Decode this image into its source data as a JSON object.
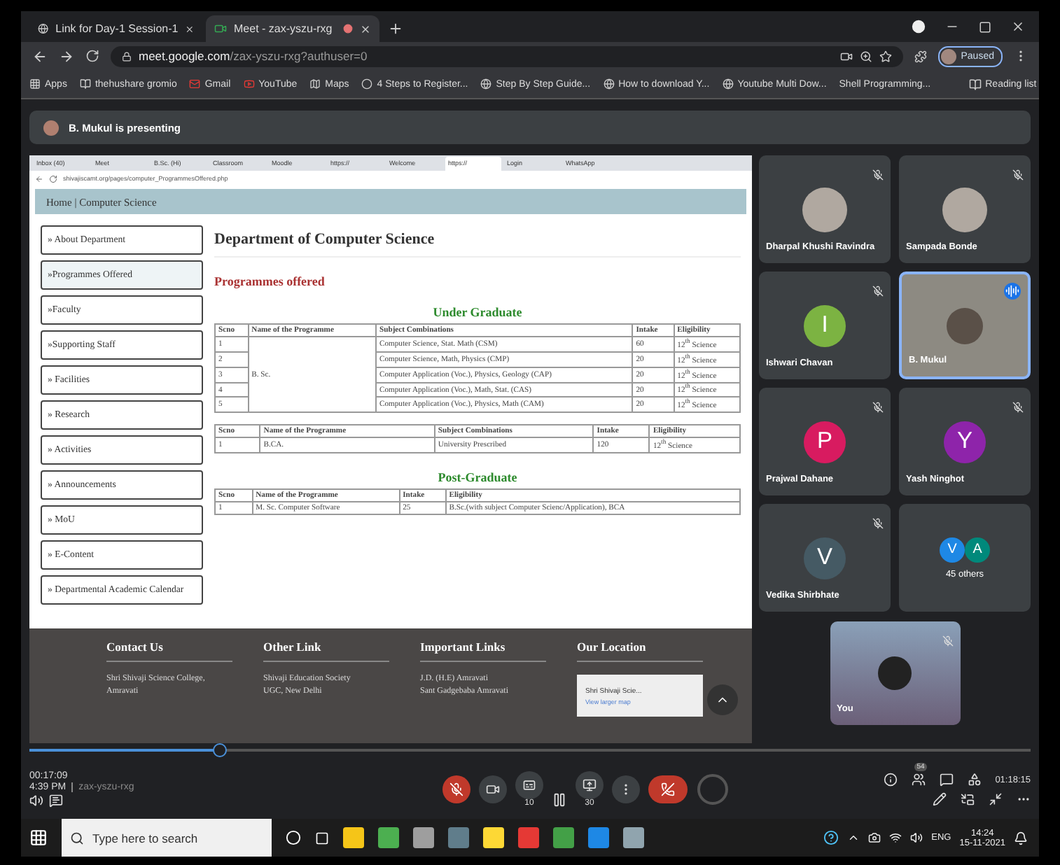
{
  "browser": {
    "tabs": [
      {
        "label": "Link for Day-1 Session-1",
        "selected": false,
        "recording": false
      },
      {
        "label": "Meet - zax-yszu-rxg",
        "selected": true,
        "recording": true
      }
    ],
    "url_host": "meet.google.com",
    "url_path": "/zax-yszu-rxg?authuser=0",
    "profile": "Paused",
    "bookmarks": [
      "Apps",
      "thehushare gromio",
      "Gmail",
      "YouTube",
      "Maps",
      "4 Steps to Register...",
      "Step By Step Guide...",
      "How to download Y...",
      "Youtube Multi Dow...",
      "Shell Programming..."
    ],
    "reading_list": "Reading list"
  },
  "presenting": "B. Mukul is presenting",
  "shared_screen": {
    "tabs": [
      {
        "label": "Inbox (40)",
        "selected": false
      },
      {
        "label": "Meet",
        "selected": false
      },
      {
        "label": "B.Sc. (Hi)",
        "selected": false
      },
      {
        "label": "Classroom",
        "selected": false
      },
      {
        "label": "Moodle",
        "selected": false
      },
      {
        "label": "https://",
        "selected": false
      },
      {
        "label": "Welcome",
        "selected": false
      },
      {
        "label": "https://",
        "selected": true
      },
      {
        "label": "Login",
        "selected": false
      },
      {
        "label": "WhatsApp",
        "selected": false
      }
    ],
    "url": "shivajiscamt.org/pages/computer_ProgrammesOffered.php",
    "breadcrumb": "Home | Computer Science",
    "menu": [
      {
        "label": "» About Department",
        "selected": false
      },
      {
        "label": "»Programmes Offered",
        "selected": true
      },
      {
        "label": "»Faculty",
        "selected": false
      },
      {
        "label": "»Supporting Staff",
        "selected": false
      },
      {
        "label": "» Facilities",
        "selected": false
      },
      {
        "label": "» Research",
        "selected": false
      },
      {
        "label": "» Activities",
        "selected": false
      },
      {
        "label": "» Announcements",
        "selected": false
      },
      {
        "label": "» MoU",
        "selected": false
      },
      {
        "label": "» E-Content",
        "selected": false
      },
      {
        "label": "» Departmental Academic Calendar",
        "selected": false
      }
    ],
    "heading": "Department of Computer Science",
    "subheading": "Programmes offered",
    "sections": [
      {
        "title": "Under Graduate",
        "tables": [
          {
            "kind": "grouped",
            "columns": [
              "Scno",
              "Name of the Programme",
              "Subject Combinations",
              "Intake",
              "Eligibility"
            ],
            "groups": [
              {
                "programme": "B. Sc.",
                "rows": [
                  [
                    "1",
                    "Computer Science, Stat. Math (CSM)",
                    "60",
                    "12$^{th}$ Science"
                  ],
                  [
                    "2",
                    "Computer Science, Math, Physics (CMP)",
                    "20",
                    "12$^{th}$ Science"
                  ],
                  [
                    "3",
                    "Computer Application (Voc.), Physics, Geology (CAP)",
                    "20",
                    "12$^{th}$ Science"
                  ],
                  [
                    "4",
                    "Computer Application (Voc.), Math, Stat. (CAS)",
                    "20",
                    "12$^{th}$ Science"
                  ],
                  [
                    "5",
                    "Computer Application (Voc.), Physics, Math (CAM)",
                    "20",
                    "12$^{th}$ Science"
                  ]
                ]
              }
            ]
          },
          {
            "kind": "plain",
            "columns": [
              "Scno",
              "Name of the Programme",
              "Subject Combinations",
              "Intake",
              "Eligibility"
            ],
            "rows": [
              [
                "1",
                "B.CA.",
                "University Prescribed",
                "120",
                "12$^{th}$ Science"
              ]
            ]
          }
        ]
      },
      {
        "title": "Post-Graduate",
        "tables": [
          {
            "kind": "plain",
            "columns": [
              "Scno",
              "Name of the Programme",
              "Intake",
              "Eligibility"
            ],
            "rows": [
              [
                "1",
                "M. Sc. Computer Software",
                "25",
                "B.Sc.(with subject Computer Scienc/Application), BCA"
              ]
            ]
          }
        ]
      }
    ],
    "footer": [
      {
        "kind": "links",
        "title": "Contact Us",
        "lines": [
          "Shri Shivaji Science College,",
          "Amravati"
        ]
      },
      {
        "kind": "links",
        "title": "Other Link",
        "lines": [
          "Shivaji Education Society",
          "UGC, New Delhi"
        ]
      },
      {
        "kind": "links",
        "title": "Important Links",
        "lines": [
          "J.D. (H.E) Amravati",
          "Sant Gadgebaba Amravati"
        ]
      },
      {
        "kind": "map",
        "title": "Our Location",
        "place": "Shri Shivaji Scie...",
        "link": "View larger map"
      }
    ]
  },
  "participants": [
    {
      "name": "Dharpal Khushi Ravindra",
      "kind": "photo",
      "muted": true,
      "speaking": false
    },
    {
      "name": "Sampada Bonde",
      "kind": "photo",
      "muted": true,
      "speaking": false
    },
    {
      "name": "Ishwari Chavan",
      "kind": "initial",
      "initial": "I",
      "color": "#7cb342",
      "muted": true,
      "speaking": false
    },
    {
      "name": "B. Mukul",
      "kind": "video",
      "muted": false,
      "speaking": true
    },
    {
      "name": "Prajwal Dahane",
      "kind": "initial",
      "initial": "P",
      "color": "#d81b60",
      "muted": true,
      "speaking": false
    },
    {
      "name": "Yash Ninghot",
      "kind": "initial",
      "initial": "Y",
      "color": "#8e24aa",
      "muted": true,
      "speaking": false
    },
    {
      "name": "Vedika Shirbhate",
      "kind": "initial",
      "initial": "V",
      "color": "#455a64",
      "muted": true,
      "speaking": false
    },
    {
      "name": "45 others",
      "kind": "others",
      "avatars": [
        {
          "initial": "V",
          "color": "#1e88e5"
        },
        {
          "initial": "A",
          "color": "#00897b"
        }
      ],
      "muted": false,
      "speaking": false
    }
  ],
  "self": {
    "label": "You",
    "muted": true
  },
  "player": {
    "elapsed": "00:17:09",
    "clock": "4:39 PM",
    "meeting": "zax-yszu-rxg",
    "duration": "01:18:15",
    "level": 0.19,
    "people_count": "54",
    "skip_back": "10",
    "skip_forward": "30"
  },
  "taskbar": {
    "search_placeholder": "Type here to search",
    "language": "ENG",
    "time": "14:24",
    "date": "15-11-2021"
  }
}
